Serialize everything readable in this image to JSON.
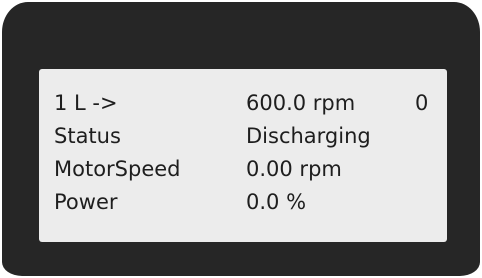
{
  "display": {
    "rows": [
      {
        "label": "1 L ->",
        "value": "600.0 rpm",
        "extra": "0"
      },
      {
        "label": "Status",
        "value": "Discharging"
      },
      {
        "label": "MotorSpeed",
        "value": "0.00 rpm"
      },
      {
        "label": "Power",
        "value": "0.0 %"
      }
    ]
  },
  "colors": {
    "bezel": "#262626",
    "screen": "#ececec",
    "text": "#1e1e1e"
  }
}
